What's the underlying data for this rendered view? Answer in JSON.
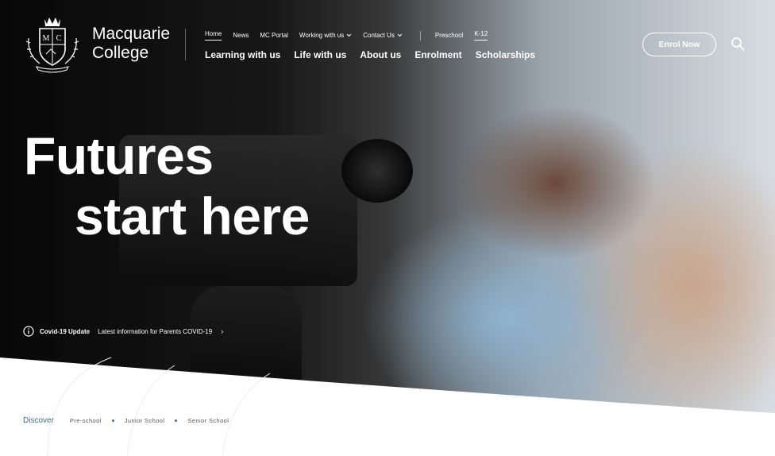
{
  "brand": {
    "name_line1": "Macquarie",
    "name_line2": "College",
    "crest_letter_left": "M",
    "crest_letter_right": "C"
  },
  "utility_nav": {
    "items": [
      {
        "label": "Home",
        "active": true,
        "dropdown": false
      },
      {
        "label": "News",
        "active": false,
        "dropdown": false
      },
      {
        "label": "MC Portal",
        "active": false,
        "dropdown": false
      },
      {
        "label": "Working with us",
        "active": false,
        "dropdown": true
      },
      {
        "label": "Contact Us",
        "active": false,
        "dropdown": true
      }
    ],
    "school_toggle": [
      {
        "label": "Preschool",
        "active": false
      },
      {
        "label": "K-12",
        "active": true
      }
    ]
  },
  "main_nav": {
    "items": [
      "Learning with us",
      "Life with us",
      "About us",
      "Enrolment",
      "Scholarships"
    ]
  },
  "header": {
    "enrol_label": "Enrol Now",
    "search_icon": "search-icon"
  },
  "hero": {
    "headline_line1": "Futures",
    "headline_line2": "start here"
  },
  "covid": {
    "title": "Covid-19 Update",
    "text": "Latest information for Parents COVID-19",
    "arrow": "›"
  },
  "discover": {
    "label": "Discover",
    "items": [
      "Pre-school",
      "Junior School",
      "Senior School"
    ]
  },
  "colors": {
    "accent_blue": "#2f6fad",
    "text_white": "#ffffff"
  }
}
